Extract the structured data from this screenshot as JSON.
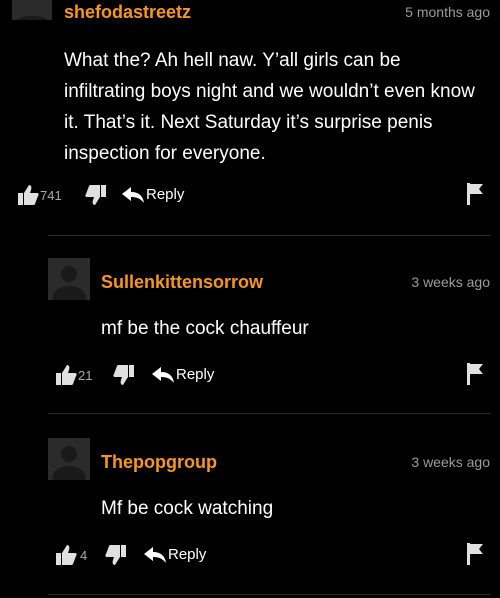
{
  "comments": [
    {
      "username": "shefodastreetz",
      "time": "5 months ago",
      "text": "What the? Ah hell naw. Y’all girls can be infiltrating boys night and we wouldn’t even know it. That’s it. Next Saturday it’s surprise penis inspection for everyone.",
      "likes": "741",
      "reply_label": "Reply"
    },
    {
      "username": "Sullenkittensorrow",
      "time": "3 weeks ago",
      "text": "mf be the cock chauffeur",
      "likes": "21",
      "reply_label": "Reply"
    },
    {
      "username": "Thepopgroup",
      "time": "3 weeks ago",
      "text": "Mf be cock watching",
      "likes": "4",
      "reply_label": "Reply"
    }
  ],
  "colors": {
    "background": "#000000",
    "username": "#f7971d",
    "text": "#ffffff",
    "muted": "#9b9b9b"
  }
}
